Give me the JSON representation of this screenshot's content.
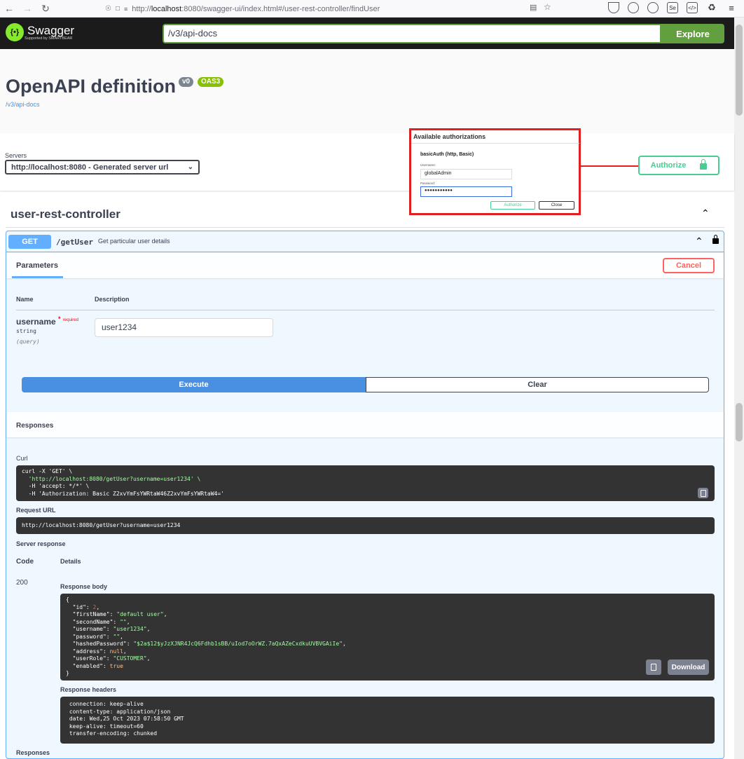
{
  "browser": {
    "url_prefix": "http://",
    "url_host": "localhost",
    "url_rest": ":8080/swagger-ui/index.html#/user-rest-controller/findUser"
  },
  "topbar": {
    "logo_text": "Swagger",
    "logo_sub": "Supported by SMARTBEAR",
    "api_url": "/v3/api-docs",
    "explore_label": "Explore"
  },
  "info": {
    "title": "OpenAPI definition",
    "version": "v0",
    "oas": "OAS3",
    "link": "/v3/api-docs"
  },
  "servers": {
    "label": "Servers",
    "selected": "http://localhost:8080 - Generated server url"
  },
  "authorize": {
    "label": "Authorize"
  },
  "auth_popup": {
    "title": "Available authorizations",
    "scheme": "basicAuth  (http, Basic)",
    "username_label": "Username:",
    "username_value": "globalAdmin",
    "password_label": "Password:",
    "password_value": "●●●●●●●●●●●",
    "authorize_btn": "Authorize",
    "close_btn": "Close"
  },
  "tag": {
    "name": "user-rest-controller"
  },
  "operation": {
    "method": "GET",
    "path": "/getUser",
    "summary": "Get particular user details",
    "params_tab": "Parameters",
    "cancel_label": "Cancel",
    "col_name": "Name",
    "col_desc": "Description",
    "param_name": "username",
    "param_required_star": "*",
    "param_required_text": "required",
    "param_type": "string",
    "param_in": "(query)",
    "param_value": "user1234",
    "execute_label": "Execute",
    "clear_label": "Clear"
  },
  "responses": {
    "heading": "Responses",
    "curl_label": "Curl",
    "curl_lines": [
      "curl -X 'GET' \\",
      "  'http://localhost:8080/getUser?username=user1234' \\",
      "  -H 'accept: */*' \\",
      "  -H 'Authorization: Basic Z2xvYmFsYWRtaW46Z2xvYmFsYWRtaW4='"
    ],
    "request_url_label": "Request URL",
    "request_url": "http://localhost:8080/getUser?username=user1234",
    "server_response_label": "Server response",
    "code_label": "Code",
    "details_label": "Details",
    "code": "200",
    "body_label": "Response body",
    "body": {
      "id": "2",
      "firstName": "\"default user\"",
      "secondName": "\"\"",
      "username": "\"user1234\"",
      "password": "\"\"",
      "hashedPassword": "\"$2a$12$yJzXJNR4JcQ6Fdhb1sBB/uIod7oOrWZ.7aQxAZeCxdkuUVBVGAiIe\"",
      "address": "null",
      "userRole": "\"CUSTOMER\"",
      "enabled": "true"
    },
    "download_label": "Download",
    "headers_label": "Response headers",
    "headers": [
      " connection: keep-alive",
      " content-type: application/json",
      " date: Wed,25 Oct 2023 07:58:50 GMT",
      " keep-alive: timeout=60",
      " transfer-encoding: chunked"
    ],
    "footer_label": "Responses"
  },
  "colors": {
    "get": "#61affe",
    "green": "#49cc90",
    "explore": "#62a03f",
    "cancel": "#ff6060",
    "execute": "#4990e2",
    "highlight": "#e02020"
  }
}
